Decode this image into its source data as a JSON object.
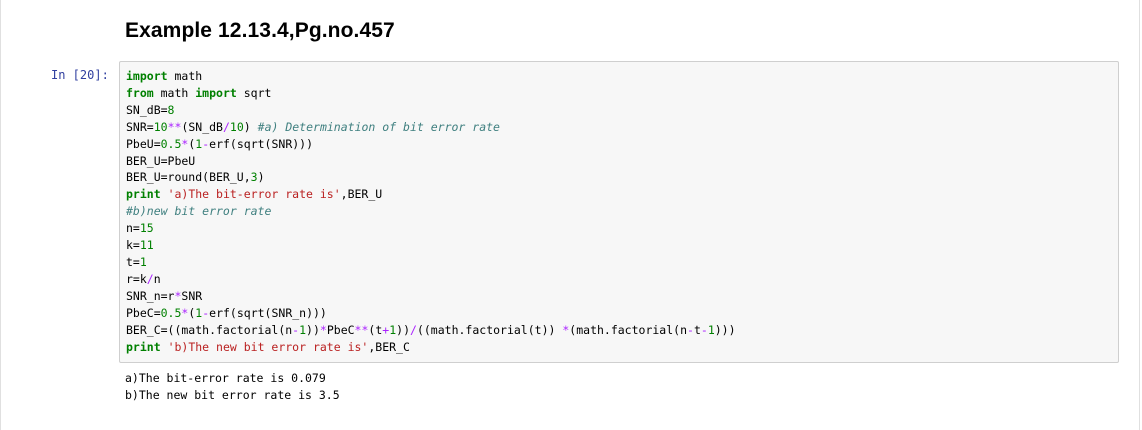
{
  "markdown_cell": {
    "heading": "Example 12.13.4,Pg.no.457"
  },
  "code_cell": {
    "prompt": "In [20]:",
    "lines": [
      "import math",
      "from math import sqrt",
      "SN_dB=8",
      "SNR=10**(SN_dB/10) #a) Determination of bit error rate",
      "PbeU=0.5*(1-erf(sqrt(SNR)))",
      "BER_U=PbeU",
      "BER_U=round(BER_U,3)",
      "print 'a)The bit-error rate is',BER_U",
      "#b)new bit error rate",
      "n=15",
      "k=11",
      "t=1",
      "r=k/n",
      "SNR_n=r*SNR",
      "PbeC=0.5*(1-erf(sqrt(SNR_n)))",
      "BER_C=((math.factorial(n-1))*PbeC**(t+1))/((math.factorial(t)) *(math.factorial(n-t-1)))",
      "print 'b)The new bit error rate is',BER_C"
    ],
    "output": [
      "a)The bit-error rate is 0.079",
      "b)The new bit error rate is 3.5"
    ]
  },
  "colors": {
    "prompt": "#303f9f",
    "keyword": "#008000",
    "number": "#008000",
    "operator": "#aa22ff",
    "string": "#ba2121",
    "comment": "#408080",
    "cell_background": "#f7f7f7",
    "cell_border": "#cfcfcf"
  }
}
